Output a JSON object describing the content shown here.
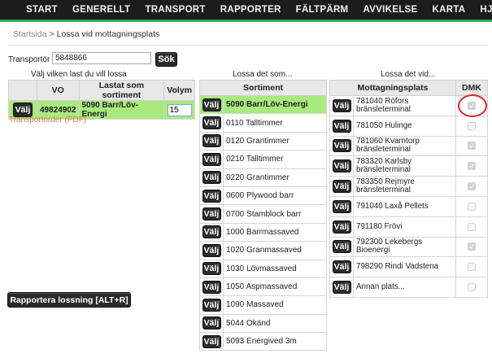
{
  "nav": [
    "START",
    "GENERELLT",
    "TRANSPORT",
    "RAPPORTER",
    "FÄLTPÄRM",
    "AVVIKELSE",
    "KARTA",
    "HJÄLP"
  ],
  "breadcrumb": {
    "home": "Startsida",
    "sep": ">",
    "current": "Lossa vid mottagningsplats"
  },
  "transportor": {
    "label": "Transportör",
    "value": "5848866",
    "search_button": "Sök"
  },
  "captions": {
    "vo": "Välj vilken last du vill lossa",
    "sortiment": "Lossa det som...",
    "mottagning": "Lossa det vid..."
  },
  "vo_table": {
    "headers": [
      "",
      "VO",
      "Lastat som sortiment",
      "Volym"
    ],
    "row": {
      "button": "Välj",
      "vo": "49824902",
      "sortiment": "5090 Barr/Löv-Energi",
      "volym": "15"
    }
  },
  "pdf_link": "Transportorder (PDF)",
  "sortiment_table": {
    "header": "Sortiment",
    "button": "Välj",
    "rows": [
      "5090 Barr/Löv-Energi",
      "0110 Talltimmer",
      "0120 Grantimmer",
      "0210 Talltimmer",
      "0220 Grantimmer",
      "0600 Plywood barr",
      "0700 Stamblock barr",
      "1000 Barrmassaved",
      "1020 Granmassaved",
      "1030 Lövmassaved",
      "1050 Aspmassaved",
      "1090 Massaved",
      "5044 Okänd",
      "5093 Energived 3m"
    ]
  },
  "mottagning_table": {
    "headers": [
      "Mottagningsplats",
      "DMK"
    ],
    "button": "Välj",
    "rows": [
      {
        "place": "781040 Röfors bränsleterminal",
        "dmk": true
      },
      {
        "place": "781050 Hulinge",
        "dmk": false
      },
      {
        "place": "781060 Kvarntorp bränsleterminal",
        "dmk": true
      },
      {
        "place": "783320 Karlsby bränsleterminal",
        "dmk": true
      },
      {
        "place": "783350 Rejmyre bränsleterminal",
        "dmk": true
      },
      {
        "place": "791040 Laxå Pellets",
        "dmk": false
      },
      {
        "place": "791180 Frövi",
        "dmk": false
      },
      {
        "place": "792300 Lekebergs Bioenergi",
        "dmk": true
      },
      {
        "place": "798290 Rindi Vadstena",
        "dmk": false
      },
      {
        "place": "Annan plats...",
        "dmk": false
      }
    ]
  },
  "rapport_button": "Rapportera lossning [ALT+R]",
  "colors": {
    "nav_bg": "#1c1c1c",
    "accent_green": "#2fa84f",
    "selected_row": "#a9ea7e",
    "highlight_circle": "#d8262e",
    "link_orange": "#e07a4a"
  }
}
